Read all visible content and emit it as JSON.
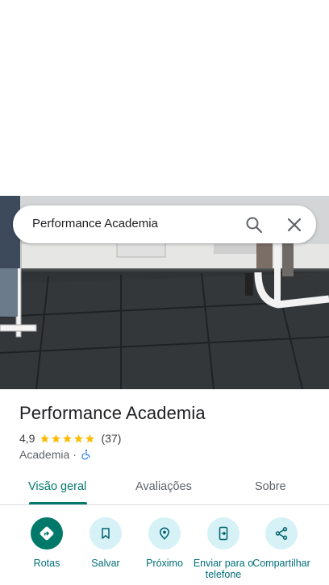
{
  "search": {
    "query": "Performance Academia",
    "search_icon": "search-icon",
    "close_icon": "close-icon"
  },
  "place": {
    "name": "Performance Academia",
    "rating": "4,9",
    "stars": 5,
    "reviews": "(37)",
    "category": "Academia",
    "separator": "·",
    "accessibility_icon": "wheelchair-icon",
    "star_color": "#fbbc04"
  },
  "tabs": [
    {
      "label": "Visão geral",
      "active": true
    },
    {
      "label": "Avaliações",
      "active": false
    },
    {
      "label": "Sobre",
      "active": false
    }
  ],
  "actions": [
    {
      "label": "Rotas",
      "icon": "directions-icon"
    },
    {
      "label": "Salvar",
      "icon": "bookmark-icon"
    },
    {
      "label": "Próximo",
      "icon": "nearby-icon"
    },
    {
      "label": "Enviar para o telefone",
      "icon": "send-to-phone-icon"
    },
    {
      "label": "Compartilhar",
      "icon": "share-icon"
    }
  ],
  "colors": {
    "accent": "#00796b",
    "action_bg": "#d6f2f6",
    "action_label": "#006d78"
  }
}
